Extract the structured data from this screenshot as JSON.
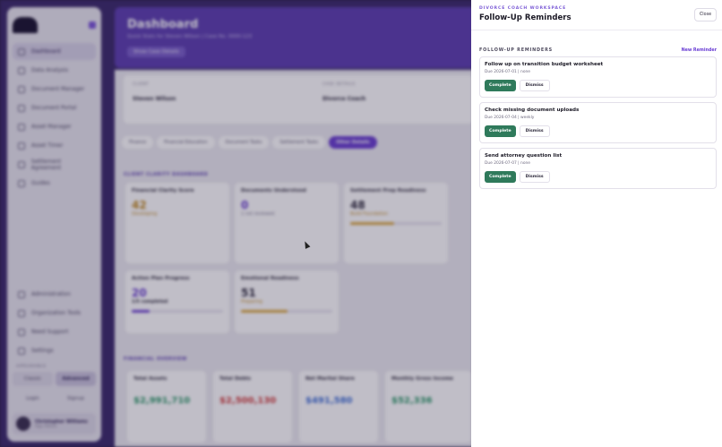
{
  "drawer": {
    "eyebrow": "DIVORCE COACH WORKSPACE",
    "title": "Follow-Up Reminders",
    "close_label": "Close",
    "list_title": "FOLLOW-UP REMINDERS",
    "new_label": "New Reminder",
    "complete_label": "Complete",
    "dismiss_label": "Dismiss",
    "reminders": [
      {
        "title": "Follow up on transition budget worksheet",
        "meta": "Due 2026-07-01 | none"
      },
      {
        "title": "Check missing document uploads",
        "meta": "Due 2026-07-04 | weekly"
      },
      {
        "title": "Send attorney question list",
        "meta": "Due 2026-07-07 | none"
      }
    ]
  },
  "background": {
    "sidebar": {
      "items": [
        "Dashboard",
        "Data Analysis",
        "Document Manager",
        "Document Portal",
        "Asset Manager",
        "Asset Timer",
        "Settlement Agreement",
        "Guides"
      ],
      "bottom_items": [
        "Administration",
        "Organization Tools",
        "Need Support",
        "Settings"
      ],
      "theme_section": "APPEARANCE",
      "theme_options": [
        "Classic",
        "Advanced"
      ],
      "auth": [
        "Login",
        "Signup"
      ],
      "user_name": "Christopher Williams",
      "user_sub": "App Admin"
    },
    "hero": {
      "title": "Dashboard",
      "subtitle": "Quick Stats for Steven Wilson | Case No. 0000-123",
      "button": "Show Case Details"
    },
    "filters": [
      {
        "label": "CLIENT",
        "value": "Steven Wilson"
      },
      {
        "label": "CASE DETAILS",
        "value": "Divorce Coach"
      }
    ],
    "tabs": [
      "Finance",
      "Financial Education",
      "Document Tasks",
      "Settlement Tasks",
      "Other Details"
    ],
    "section_clarity": "CLIENT CLARITY DASHBOARD",
    "section_financial": "FINANCIAL OVERVIEW",
    "cards": [
      {
        "title": "Financial Clarity Score",
        "value": "42",
        "note": "Developing"
      },
      {
        "title": "Documents Understood",
        "value": "0",
        "note": "1 not reviewed"
      },
      {
        "title": "Settlement Prep Readiness",
        "value": "48",
        "note": "Build Foundation"
      },
      {
        "title": "Action Plan Progress",
        "value": "20",
        "note": "1/5 completed"
      },
      {
        "title": "Emotional Readiness",
        "value": "51",
        "note": "Preparing"
      }
    ],
    "money_cards": [
      {
        "title": "Total Assets",
        "value": "$2,991,710"
      },
      {
        "title": "Total Debts",
        "value": "$2,500,130"
      },
      {
        "title": "Net Marital Share",
        "value": "$491,580"
      },
      {
        "title": "Monthly Gross Income",
        "value": "$52,336"
      }
    ]
  },
  "colors": {
    "accent": "#6b3fd4",
    "complete": "#2f7a5b",
    "hero": "#5d3fb0"
  }
}
